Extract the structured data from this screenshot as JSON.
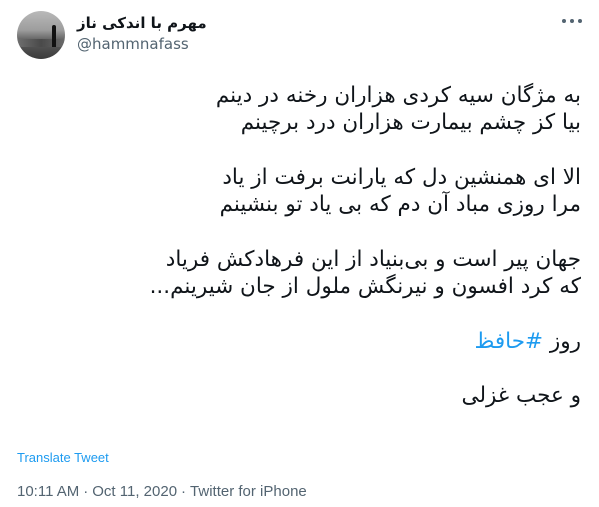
{
  "user": {
    "display_name": "مهرم با اندکی ناز",
    "handle": "@hammnafass"
  },
  "tweet": {
    "lines_1": [
      "به مژگان سیه کردی هزاران رخنه در دینم",
      "بیا کز چشم بیمارت هزاران درد برچینم"
    ],
    "lines_2": [
      "الا ای همنشین دل که یارانت برفت از یاد",
      "مرا روزی مباد آن دم که بی یاد تو بنشینم"
    ],
    "lines_3": [
      "جهان پیر است و بی‌بنیاد از این فرهادکش فریاد",
      "که کرد افسون و نیرنگش ملول از جان شیرینم..."
    ],
    "hashtag_prefix": "روز",
    "hashtag": "#حافظ",
    "closing": "و عجب غزلی"
  },
  "translate_label": "Translate Tweet",
  "meta": {
    "time": "10:11 AM",
    "separator": "·",
    "date": "Oct 11, 2020",
    "source": "Twitter for iPhone"
  },
  "icons": {
    "more": "more-horizontal-icon",
    "avatar": "profile-avatar"
  },
  "colors": {
    "link": "#1d9bf0",
    "secondary_text": "#536471",
    "primary_text": "#0f1419"
  }
}
